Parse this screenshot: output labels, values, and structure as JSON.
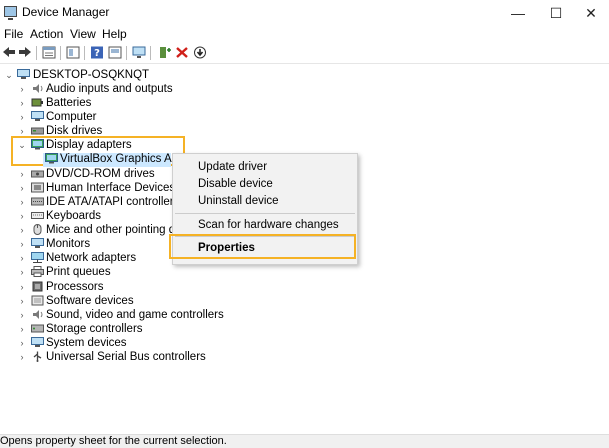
{
  "window": {
    "title": "Device Manager",
    "minimize": "—",
    "maximize": "☐",
    "close": "✕"
  },
  "menu": [
    "File",
    "Action",
    "View",
    "Help"
  ],
  "toolbar_icons": [
    "back-arrow-icon",
    "forward-arrow-icon",
    "properties-sheet-icon",
    "show-hide-tree-icon",
    "help-icon",
    "device-properties-icon",
    "scan-monitor-icon",
    "add-driver-icon",
    "uninstall-x-icon",
    "download-update-icon"
  ],
  "tree": {
    "root": "DESKTOP-OSQKNQT",
    "items": [
      {
        "label": "Audio inputs and outputs",
        "icon": "speaker-icon"
      },
      {
        "label": "Batteries",
        "icon": "battery-icon"
      },
      {
        "label": "Computer",
        "icon": "computer-icon"
      },
      {
        "label": "Disk drives",
        "icon": "disk-icon"
      },
      {
        "label": "Display adapters",
        "icon": "display-adapter-icon",
        "expanded": true
      },
      {
        "label": "VirtualBox Graphics Adapt",
        "icon": "display-adapter-icon",
        "child": true,
        "selected": true
      },
      {
        "label": "DVD/CD-ROM drives",
        "icon": "dvd-icon"
      },
      {
        "label": "Human Interface Devices",
        "icon": "hid-icon"
      },
      {
        "label": "IDE ATA/ATAPI controllers",
        "icon": "ide-icon"
      },
      {
        "label": "Keyboards",
        "icon": "keyboard-icon"
      },
      {
        "label": "Mice and other pointing devic",
        "icon": "mouse-icon"
      },
      {
        "label": "Monitors",
        "icon": "monitor-icon"
      },
      {
        "label": "Network adapters",
        "icon": "network-icon"
      },
      {
        "label": "Print queues",
        "icon": "printer-icon"
      },
      {
        "label": "Processors",
        "icon": "processor-icon"
      },
      {
        "label": "Software devices",
        "icon": "software-device-icon"
      },
      {
        "label": "Sound, video and game controllers",
        "icon": "sound-icon"
      },
      {
        "label": "Storage controllers",
        "icon": "storage-icon"
      },
      {
        "label": "System devices",
        "icon": "system-icon"
      },
      {
        "label": "Universal Serial Bus controllers",
        "icon": "usb-icon"
      }
    ]
  },
  "context_menu": {
    "update_driver": "Update driver",
    "disable_device": "Disable device",
    "uninstall_device": "Uninstall device",
    "scan": "Scan for hardware changes",
    "properties": "Properties"
  },
  "status": "Opens property sheet for the current selection.",
  "colors": {
    "highlight": "#f5b225",
    "selection": "#cce8ff"
  }
}
